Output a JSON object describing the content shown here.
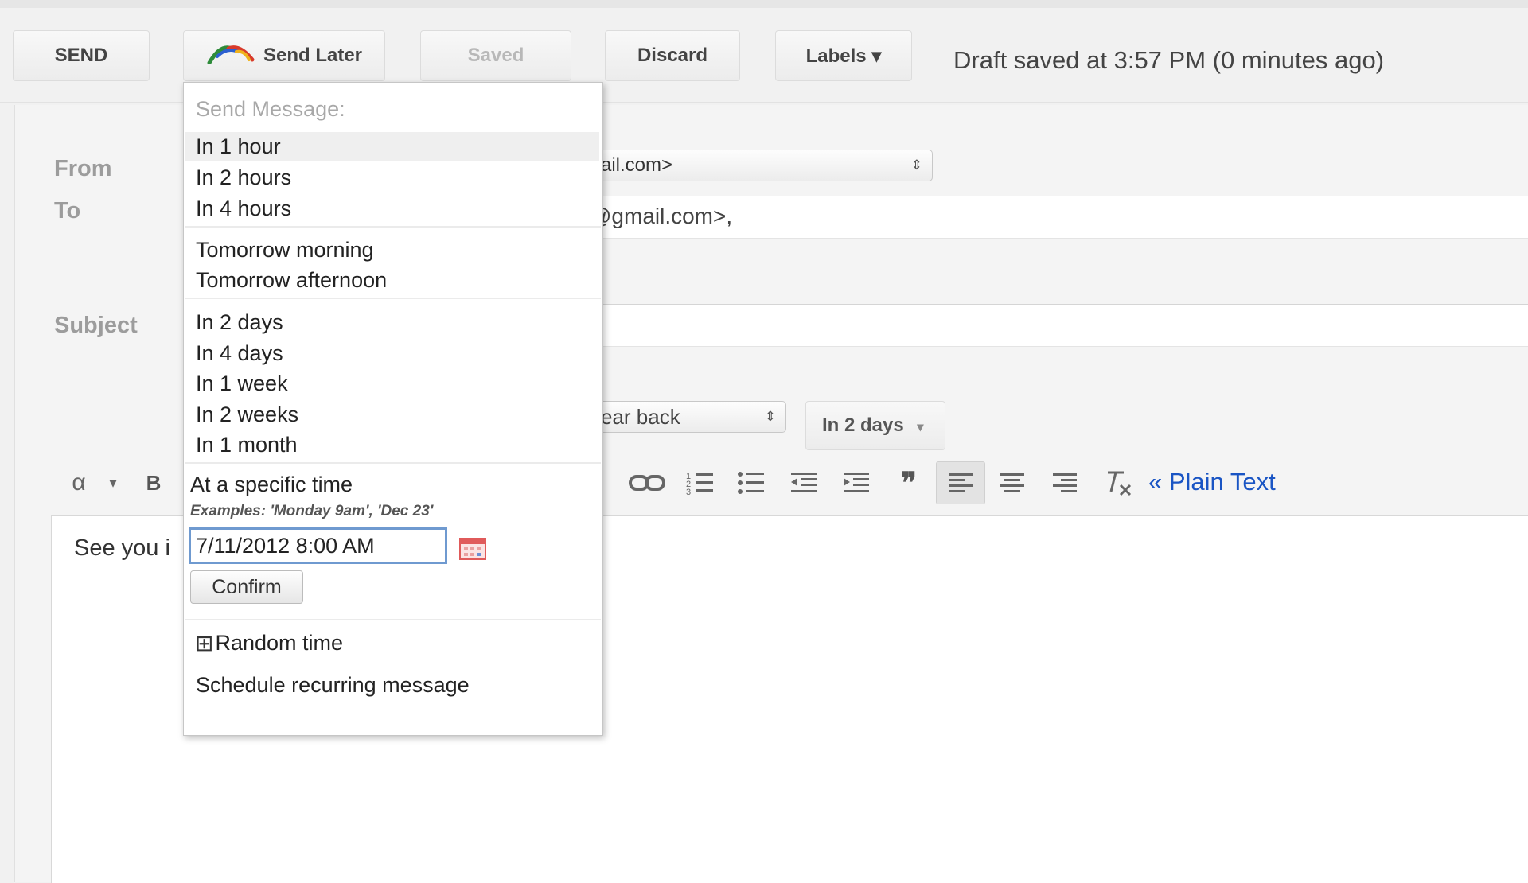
{
  "toolbar": {
    "send_label": "SEND",
    "send_later_label": "Send Later",
    "saved_label": "Saved",
    "discard_label": "Discard",
    "labels_label": "Labels ▾",
    "draft_status": "Draft saved at 3:57 PM (0 minutes ago)"
  },
  "compose": {
    "from_label": "From",
    "from_value": "ail.com>",
    "to_label": "To",
    "to_value": "@gmail.com>,",
    "subject_label": "Subject",
    "followup_value": "ear back",
    "followup_days": "In 2 days",
    "body_text": "See you i"
  },
  "format_bar": {
    "font_icon": "α",
    "font_dropdown": "▾",
    "bold_icon": "B",
    "plain_text_label": "« Plain Text"
  },
  "send_later_menu": {
    "header": "Send Message:",
    "quick_options": [
      "In 1 hour",
      "In 2 hours",
      "In 4 hours"
    ],
    "tomorrow_options": [
      "Tomorrow morning",
      "Tomorrow afternoon"
    ],
    "later_options": [
      "In 2 days",
      "In 4 days",
      "In 1 week",
      "In 2 weeks",
      "In 1 month"
    ],
    "specific_time_label": "At a specific time",
    "examples_text": "Examples: 'Monday 9am', 'Dec 23'",
    "datetime_value": "7/11/2012 8:00 AM",
    "confirm_label": "Confirm",
    "random_time_label": "Random time",
    "recurring_label": "Schedule recurring message"
  }
}
